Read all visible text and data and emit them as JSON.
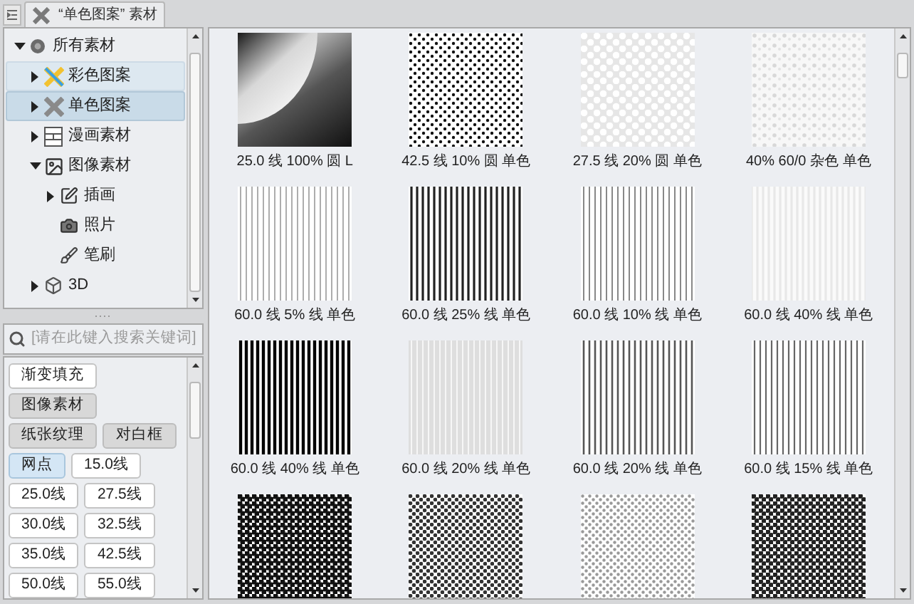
{
  "tab": {
    "title": "“单色图案” 素材"
  },
  "tree": [
    {
      "label": "所有素材",
      "kind": "all",
      "expanded": true,
      "selected": false,
      "hovered": false,
      "children": [
        {
          "label": "彩色图案",
          "kind": "color",
          "expanded": false,
          "selected": false,
          "hovered": true
        },
        {
          "label": "单色图案",
          "kind": "mono",
          "expanded": false,
          "selected": true,
          "hovered": false
        },
        {
          "label": "漫画素材",
          "kind": "manga",
          "expanded": false,
          "selected": false,
          "hovered": false
        },
        {
          "label": "图像素材",
          "kind": "image",
          "expanded": true,
          "selected": false,
          "hovered": false,
          "children": [
            {
              "label": "插画",
              "kind": "illustration",
              "expanded": false,
              "selected": false,
              "hovered": false
            },
            {
              "label": "照片",
              "kind": "photo",
              "selected": false,
              "hovered": false
            },
            {
              "label": "笔刷",
              "kind": "brush",
              "selected": false,
              "hovered": false
            }
          ]
        },
        {
          "label": "3D",
          "kind": "cube",
          "expanded": false,
          "selected": false,
          "hovered": false
        }
      ]
    }
  ],
  "search": {
    "placeholder": "[请在此键入搜索关键词]"
  },
  "tags": [
    {
      "label": "渐变填充",
      "selected": false,
      "muted": false
    },
    {
      "label": "图像素材",
      "selected": false,
      "muted": true
    },
    {
      "label": "纸张纹理",
      "selected": false,
      "muted": true
    },
    {
      "label": "对白框",
      "selected": false,
      "muted": true
    },
    {
      "label": "网点",
      "selected": true,
      "muted": false
    },
    {
      "label": "15.0线",
      "selected": false,
      "muted": false
    },
    {
      "label": "25.0线",
      "selected": false,
      "muted": false
    },
    {
      "label": "27.5线",
      "selected": false,
      "muted": false
    },
    {
      "label": "30.0线",
      "selected": false,
      "muted": false
    },
    {
      "label": "32.5线",
      "selected": false,
      "muted": false
    },
    {
      "label": "35.0线",
      "selected": false,
      "muted": false
    },
    {
      "label": "42.5线",
      "selected": false,
      "muted": false
    },
    {
      "label": "50.0线",
      "selected": false,
      "muted": false
    },
    {
      "label": "55.0线",
      "selected": false,
      "muted": false
    }
  ],
  "materials": [
    {
      "kind": "gradient",
      "caption": "25.0 线 100% 圆 L"
    },
    {
      "kind": "dots",
      "caption": "42.5 线 10% 圆 单色"
    },
    {
      "kind": "whitedots",
      "caption": "27.5 线 20% 圆 单色"
    },
    {
      "kind": "noise",
      "caption": "40% 60/0 杂色 单色"
    },
    {
      "kind": "thinlines",
      "caption": "60.0 线 5% 线 单色"
    },
    {
      "kind": "boldlines",
      "caption": "60.0 线 25% 线 单色"
    },
    {
      "kind": "greylines",
      "caption": "60.0 线 10% 线 单色"
    },
    {
      "kind": "palelines",
      "caption": "60.0 线 40% 线 单色"
    },
    {
      "kind": "blacklines",
      "caption": "60.0 线 40% 线 单色"
    },
    {
      "kind": "faintlines",
      "caption": "60.0 线 20% 线 单色"
    },
    {
      "kind": "darkgreylines",
      "caption": "60.0 线 20% 线 单色"
    },
    {
      "kind": "midlines",
      "caption": "60.0 线 15% 线 单色"
    },
    {
      "kind": "densedots"
    },
    {
      "kind": "halftone"
    },
    {
      "kind": "lighthalftone"
    },
    {
      "kind": "darkhalftone"
    }
  ]
}
